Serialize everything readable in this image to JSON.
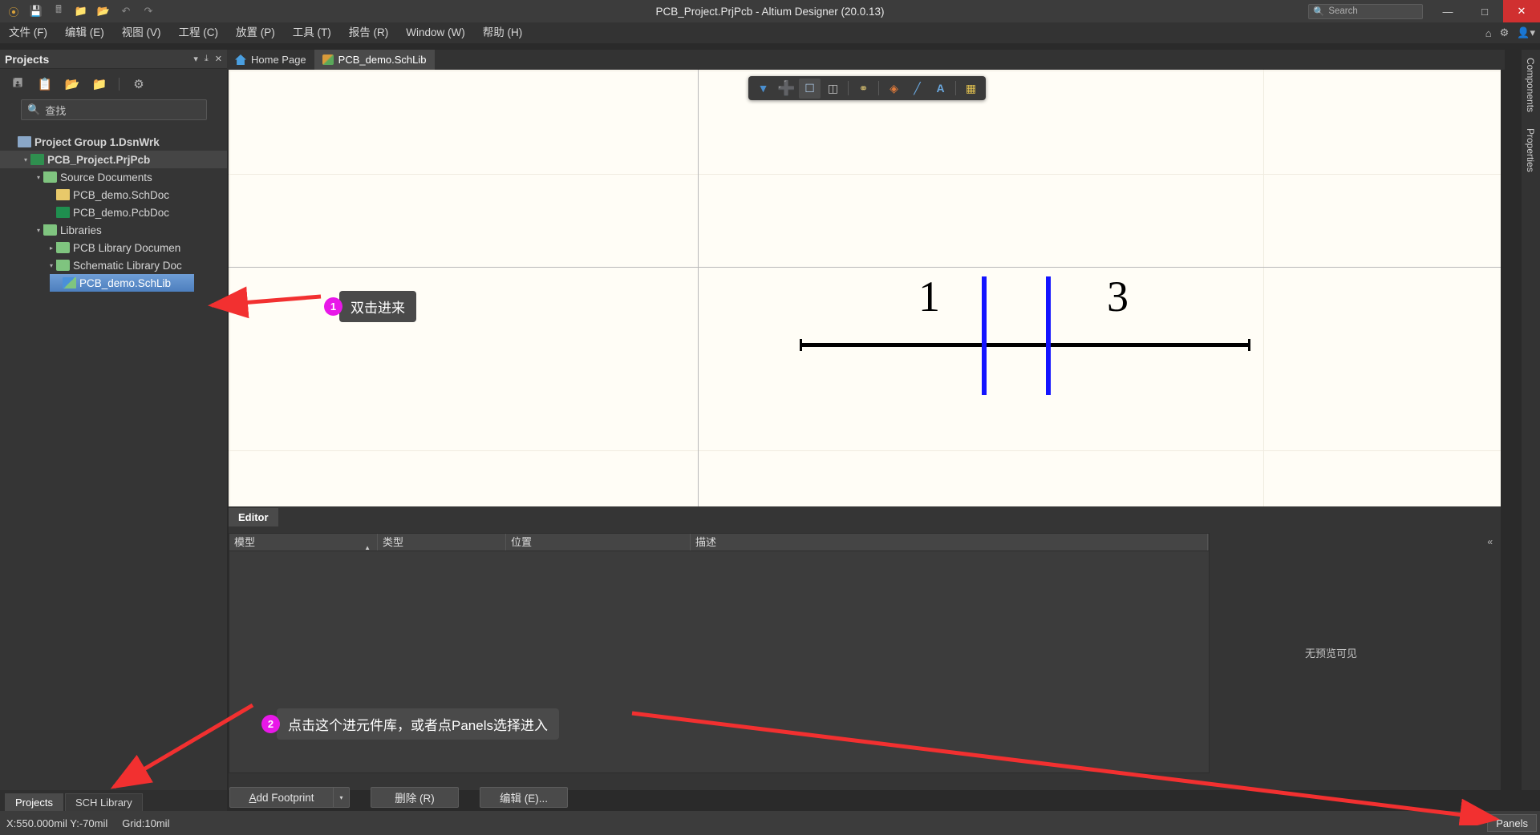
{
  "window": {
    "title": "PCB_Project.PrjPcb - Altium Designer (20.0.13)",
    "search_placeholder": "Search",
    "minimize": "—",
    "maximize": "□",
    "close": "✕"
  },
  "title_icons": [
    "altium-logo",
    "save-icon",
    "save-all-icon",
    "open-icon",
    "open-project-icon",
    "undo-icon",
    "redo-icon"
  ],
  "menubar": {
    "items": [
      {
        "label": "文件 (F)",
        "name": "menu-file"
      },
      {
        "label": "编辑 (E)",
        "name": "menu-edit"
      },
      {
        "label": "视图 (V)",
        "name": "menu-view"
      },
      {
        "label": "工程 (C)",
        "name": "menu-project"
      },
      {
        "label": "放置 (P)",
        "name": "menu-place"
      },
      {
        "label": "工具 (T)",
        "name": "menu-tools"
      },
      {
        "label": "报告 (R)",
        "name": "menu-reports"
      },
      {
        "label": "Window (W)",
        "name": "menu-window"
      },
      {
        "label": "帮助 (H)",
        "name": "menu-help"
      }
    ],
    "right_icons": [
      "home-icon",
      "gear-icon",
      "user-icon"
    ]
  },
  "projects_panel": {
    "title": "Projects",
    "dropdown": "▾",
    "pin": "⤓",
    "close": "✕",
    "toolbar_icons": [
      "save-icon",
      "compile-icon",
      "open-folder-icon",
      "open-folder-options-icon",
      "gear-icon"
    ],
    "search_placeholder": "查找",
    "tree": [
      {
        "label": "Project Group 1.DsnWrk",
        "indent": 0,
        "icon": "workspace-icon",
        "arrow": "",
        "bold": true,
        "state": ""
      },
      {
        "label": "PCB_Project.PrjPcb",
        "indent": 1,
        "icon": "project-icon",
        "arrow": "▾",
        "bold": true,
        "state": "active"
      },
      {
        "label": "Source Documents",
        "indent": 2,
        "icon": "folder-icon",
        "arrow": "▾",
        "bold": false,
        "state": ""
      },
      {
        "label": "PCB_demo.SchDoc",
        "indent": 3,
        "icon": "schdoc-icon",
        "arrow": "",
        "bold": false,
        "state": ""
      },
      {
        "label": "PCB_demo.PcbDoc",
        "indent": 3,
        "icon": "pcbdoc-icon",
        "arrow": "",
        "bold": false,
        "state": ""
      },
      {
        "label": "Libraries",
        "indent": 2,
        "icon": "folder-icon",
        "arrow": "▾",
        "bold": false,
        "state": ""
      },
      {
        "label": "PCB Library Documen",
        "indent": 3,
        "icon": "folder-icon",
        "arrow": "▸",
        "bold": false,
        "state": ""
      },
      {
        "label": "Schematic Library Doc",
        "indent": 3,
        "icon": "folder-icon",
        "arrow": "▾",
        "bold": false,
        "state": ""
      },
      {
        "label": "PCB_demo.SchLib",
        "indent": 4,
        "icon": "schlib-icon",
        "arrow": "",
        "bold": false,
        "state": "selected"
      }
    ],
    "bottom_tabs": [
      {
        "label": "Projects",
        "active": true
      },
      {
        "label": "SCH Library",
        "active": false
      }
    ]
  },
  "doc_tabs": [
    {
      "label": "Home Page",
      "icon": "home-icon",
      "active": false
    },
    {
      "label": "PCB_demo.SchLib",
      "icon": "schlib-icon",
      "active": true
    }
  ],
  "canvas": {
    "float_toolbar_icons": [
      "filter-icon",
      "crosshair-icon",
      "rectangle-select-icon",
      "align-icon",
      "pin-icon",
      "polygon-icon",
      "line-icon",
      "text-icon",
      "component-icon"
    ],
    "symbol": {
      "pin_labels": [
        "1",
        "3"
      ],
      "type": "capacitor-symbol"
    }
  },
  "editor_strip": {
    "tab_label": "Editor"
  },
  "model_table": {
    "columns": [
      "模型",
      "类型",
      "位置",
      "描述"
    ],
    "sort_column": "模型",
    "sort_arrow": "▲",
    "rows": [],
    "preview_text": "无预览可见",
    "collapse_icon": "«"
  },
  "buttons": {
    "add_footprint": "Add Footprint",
    "add_footprint_mnemonic": "A",
    "add_footprint_arrow": "▾",
    "delete": "删除 (R)",
    "edit": "编辑 (E)..."
  },
  "statusbar": {
    "coords": "X:550.000mil Y:-70mil",
    "grid": "Grid:10mil",
    "panels_button": "Panels"
  },
  "right_dock": {
    "tabs": [
      "Components",
      "Properties"
    ]
  },
  "annotations": [
    {
      "number": "1",
      "text": "双击进来"
    },
    {
      "number": "2",
      "text": "点击这个进元件库，或者点Panels选择进入"
    }
  ]
}
